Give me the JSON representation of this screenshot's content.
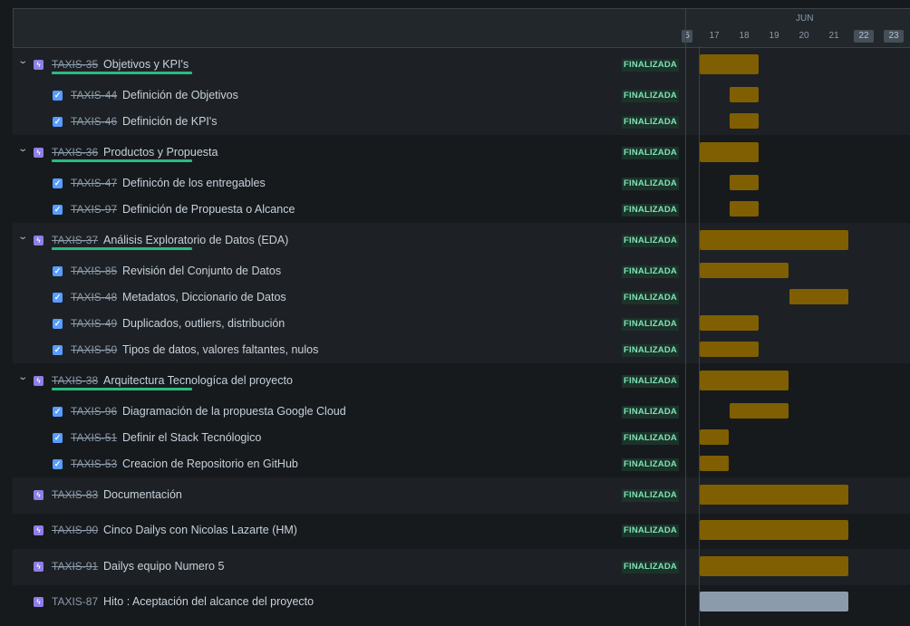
{
  "timeline": {
    "month": "JUN",
    "days": [
      {
        "label": "5",
        "weekend": true
      },
      {
        "label": "17",
        "weekend": false
      },
      {
        "label": "18",
        "weekend": false
      },
      {
        "label": "19",
        "weekend": false
      },
      {
        "label": "20",
        "weekend": false
      },
      {
        "label": "21",
        "weekend": false
      },
      {
        "label": "22",
        "weekend": true
      },
      {
        "label": "23",
        "weekend": true
      }
    ]
  },
  "colors": {
    "epic_icon": "#8f7ee7",
    "task_icon": "#579dff",
    "bar_done": "#7f5f01",
    "bar_todo": "#8c9bab",
    "status_text": "#7ee2b8",
    "progress": "#2abb7f"
  },
  "rows": [
    {
      "type": "epic",
      "key": "TAXIS-35",
      "title": "Objetivos y KPI's",
      "status": "FINALIZADA",
      "done": true,
      "collapsible": true,
      "progress": 100,
      "start": "Jun 17",
      "end": "Jun 18"
    },
    {
      "type": "task",
      "key": "TAXIS-44",
      "title": "Definición de Objetivos",
      "status": "FINALIZADA",
      "done": true,
      "start": "Jun 18",
      "end": "Jun 18"
    },
    {
      "type": "task",
      "key": "TAXIS-46",
      "title": "Definición de KPI's",
      "status": "FINALIZADA",
      "done": true,
      "start": "Jun 18",
      "end": "Jun 18"
    },
    {
      "type": "epic",
      "key": "TAXIS-36",
      "title": "Productos y Propuesta",
      "status": "FINALIZADA",
      "done": true,
      "collapsible": true,
      "progress": 100,
      "start": "Jun 17",
      "end": "Jun 18"
    },
    {
      "type": "task",
      "key": "TAXIS-47",
      "title": "Definicón de los entregables",
      "status": "FINALIZADA",
      "done": true,
      "start": "Jun 18",
      "end": "Jun 18"
    },
    {
      "type": "task",
      "key": "TAXIS-97",
      "title": "Definición de Propuesta o Alcance",
      "status": "FINALIZADA",
      "done": true,
      "start": "Jun 18",
      "end": "Jun 18"
    },
    {
      "type": "epic",
      "key": "TAXIS-37",
      "title": "Análisis Exploratorio de Datos (EDA)",
      "status": "FINALIZADA",
      "done": true,
      "collapsible": true,
      "progress": 100,
      "start": "Jun 17",
      "end": "Jun 21"
    },
    {
      "type": "task",
      "key": "TAXIS-85",
      "title": "Revisión del Conjunto de Datos",
      "status": "FINALIZADA",
      "done": true,
      "start": "Jun 17",
      "end": "Jun 19"
    },
    {
      "type": "task",
      "key": "TAXIS-48",
      "title": "Metadatos, Diccionario de Datos",
      "status": "FINALIZADA",
      "done": true,
      "start": "Jun 20",
      "end": "Jun 21"
    },
    {
      "type": "task",
      "key": "TAXIS-49",
      "title": "Duplicados, outliers, distribución",
      "status": "FINALIZADA",
      "done": true,
      "start": "Jun 17",
      "end": "Jun 18"
    },
    {
      "type": "task",
      "key": "TAXIS-50",
      "title": "Tipos de datos, valores faltantes, nulos",
      "status": "FINALIZADA",
      "done": true,
      "start": "Jun 17",
      "end": "Jun 18"
    },
    {
      "type": "epic",
      "key": "TAXIS-38",
      "title": "Arquitectura Tecnologíca del proyecto",
      "status": "FINALIZADA",
      "done": true,
      "collapsible": true,
      "progress": 100,
      "start": "Jun 17",
      "end": "Jun 19"
    },
    {
      "type": "task",
      "key": "TAXIS-96",
      "title": "Diagramación de la propuesta Google Cloud",
      "status": "FINALIZADA",
      "done": true,
      "start": "Jun 18",
      "end": "Jun 19"
    },
    {
      "type": "task",
      "key": "TAXIS-51",
      "title": "Definir el Stack Tecnólogico",
      "status": "FINALIZADA",
      "done": true,
      "start": "Jun 17",
      "end": "Jun 17"
    },
    {
      "type": "task",
      "key": "TAXIS-53",
      "title": "Creacion de Repositorio en GitHub",
      "status": "FINALIZADA",
      "done": true,
      "start": "Jun 17",
      "end": "Jun 17"
    },
    {
      "type": "epic",
      "key": "TAXIS-83",
      "title": "Documentación",
      "status": "FINALIZADA",
      "done": true,
      "collapsible": false,
      "start": "Jun 17",
      "end": "Jun 21"
    },
    {
      "type": "epic",
      "key": "TAXIS-90",
      "title": "Cinco Dailys con Nicolas Lazarte (HM)",
      "status": "FINALIZADA",
      "done": true,
      "collapsible": false,
      "start": "Jun 17",
      "end": "Jun 21"
    },
    {
      "type": "epic",
      "key": "TAXIS-91",
      "title": "Dailys equipo Numero 5",
      "status": "FINALIZADA",
      "done": true,
      "collapsible": false,
      "start": "Jun 17",
      "end": "Jun 21"
    },
    {
      "type": "epic",
      "key": "TAXIS-87",
      "title": "Hito : Aceptación del alcance del proyecto",
      "status": "",
      "done": false,
      "collapsible": false,
      "start": "Jun 17",
      "end": "Jun 21"
    }
  ]
}
